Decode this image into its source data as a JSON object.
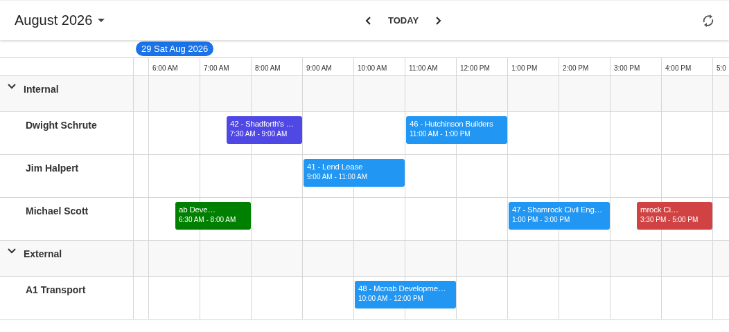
{
  "header": {
    "title": "August 2026",
    "today": "TODAY"
  },
  "date_badge": "29 Sat Aug 2026",
  "hours": [
    "6:00 AM",
    "7:00 AM",
    "8:00 AM",
    "9:00 AM",
    "10:00 AM",
    "11:00 AM",
    "12:00 PM",
    "1:00 PM",
    "2:00 PM",
    "3:00 PM",
    "4:00 PM",
    "5:0"
  ],
  "groups": [
    {
      "name": "Internal",
      "expanded": true,
      "resources": [
        {
          "name": "Dwight Schrute",
          "events": [
            {
              "title": "42 - Shadforth's …",
              "time": "7:30 AM - 9:00 AM",
              "color": "#5048e5"
            },
            {
              "title": "46 - Hutchinson Builders",
              "time": "11:00 AM - 1:00 PM",
              "color": "#2196f3"
            }
          ]
        },
        {
          "name": "Jim Halpert",
          "events": [
            {
              "title": "41 - Lend Lease",
              "time": "9:00 AM - 11:00 AM",
              "color": "#2196f3"
            }
          ]
        },
        {
          "name": "Michael Scott",
          "events": [
            {
              "title": "ab Deve…",
              "time": "6:30 AM - 8:00 AM",
              "color": "#008000"
            },
            {
              "title": "47 - Shamrock Civil Eng…",
              "time": "1:00 PM - 3:00 PM",
              "color": "#2196f3"
            },
            {
              "title": "mrock Ci…",
              "time": "3:30 PM - 5:00 PM",
              "color": "#d14343"
            }
          ]
        }
      ]
    },
    {
      "name": "External",
      "expanded": true,
      "resources": [
        {
          "name": "A1 Transport",
          "events": [
            {
              "title": "48 - Mcnab Developme…",
              "time": "10:00 AM - 12:00 PM",
              "color": "#2196f3"
            }
          ]
        }
      ]
    }
  ]
}
